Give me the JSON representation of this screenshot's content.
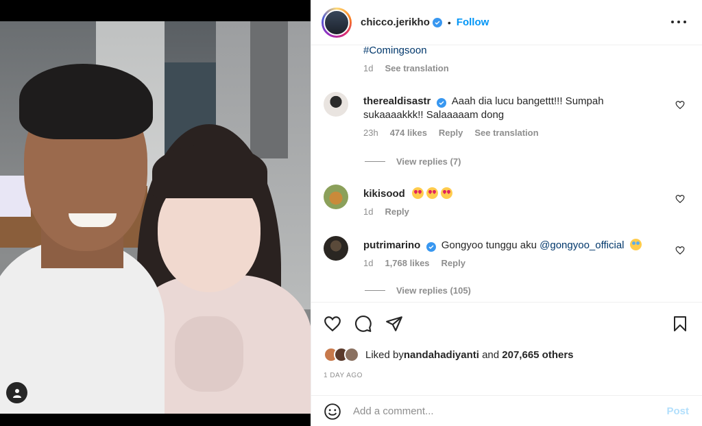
{
  "post": {
    "author": "chicco.jerikho",
    "follow_label": "Follow",
    "separator": "•"
  },
  "caption": {
    "tail_text": "#Comingsoon",
    "age": "1d",
    "see_translation": "See translation"
  },
  "comments": [
    {
      "username": "therealdisastr",
      "text": "Aaah dia lucu bangettt!!! Sumpah sukaaaakkk!! Salaaaaam dong",
      "age": "23h",
      "likes": "474 likes",
      "reply": "Reply",
      "see_translation": "See translation",
      "view_replies": "View replies (7)"
    },
    {
      "username": "kikisood",
      "text": "",
      "emoji": [
        "heart-eyes-emoji",
        "heart-eyes-emoji",
        "heart-eyes-emoji"
      ],
      "age": "1d",
      "reply": "Reply"
    },
    {
      "username": "putrimarino",
      "text_before": "Gongyoo tunggu aku ",
      "mention": "@gongyoo_official",
      "emoji": [
        "crying-emoji"
      ],
      "age": "1d",
      "likes": "1,768 likes",
      "reply": "Reply",
      "view_replies": "View replies (105)"
    }
  ],
  "likes": {
    "prefix": "Liked by ",
    "liker": "nandahadiyanti",
    "middle": " and ",
    "count": "207,665 others"
  },
  "timestamp": "1 DAY AGO",
  "add_comment": {
    "placeholder": "Add a comment...",
    "post_label": "Post"
  },
  "colors": {
    "link_blue": "#0095f6",
    "verified_blue": "#3897f0",
    "muted": "#8e8e8e",
    "post_disabled": "#b2dffc"
  }
}
